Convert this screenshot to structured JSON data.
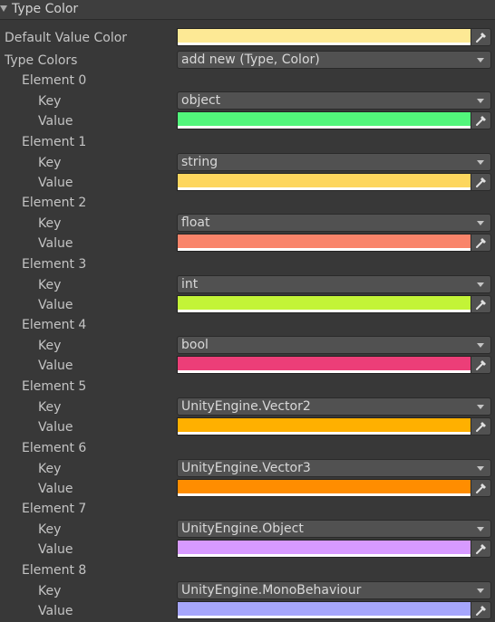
{
  "header": {
    "title": "Type Color"
  },
  "default_value": {
    "label": "Default Value Color",
    "color": "#fde995"
  },
  "type_colors": {
    "label": "Type Colors",
    "dropdown_value": "add new (Type, Color)"
  },
  "key_label": "Key",
  "value_label": "Value",
  "elements": [
    {
      "label": "Element 0",
      "key": "object",
      "color": "#52f67b"
    },
    {
      "label": "Element 1",
      "key": "string",
      "color": "#fdd65e"
    },
    {
      "label": "Element 2",
      "key": "float",
      "color": "#f9846a"
    },
    {
      "label": "Element 3",
      "key": "int",
      "color": "#c3f437"
    },
    {
      "label": "Element 4",
      "key": "bool",
      "color": "#ec3e78"
    },
    {
      "label": "Element 5",
      "key": "UnityEngine.Vector2",
      "color": "#ffb000"
    },
    {
      "label": "Element 6",
      "key": "UnityEngine.Vector3",
      "color": "#ff8d00"
    },
    {
      "label": "Element 7",
      "key": "UnityEngine.Object",
      "color": "#d79aff"
    },
    {
      "label": "Element 8",
      "key": "UnityEngine.MonoBehaviour",
      "color": "#a6a6fb"
    }
  ]
}
